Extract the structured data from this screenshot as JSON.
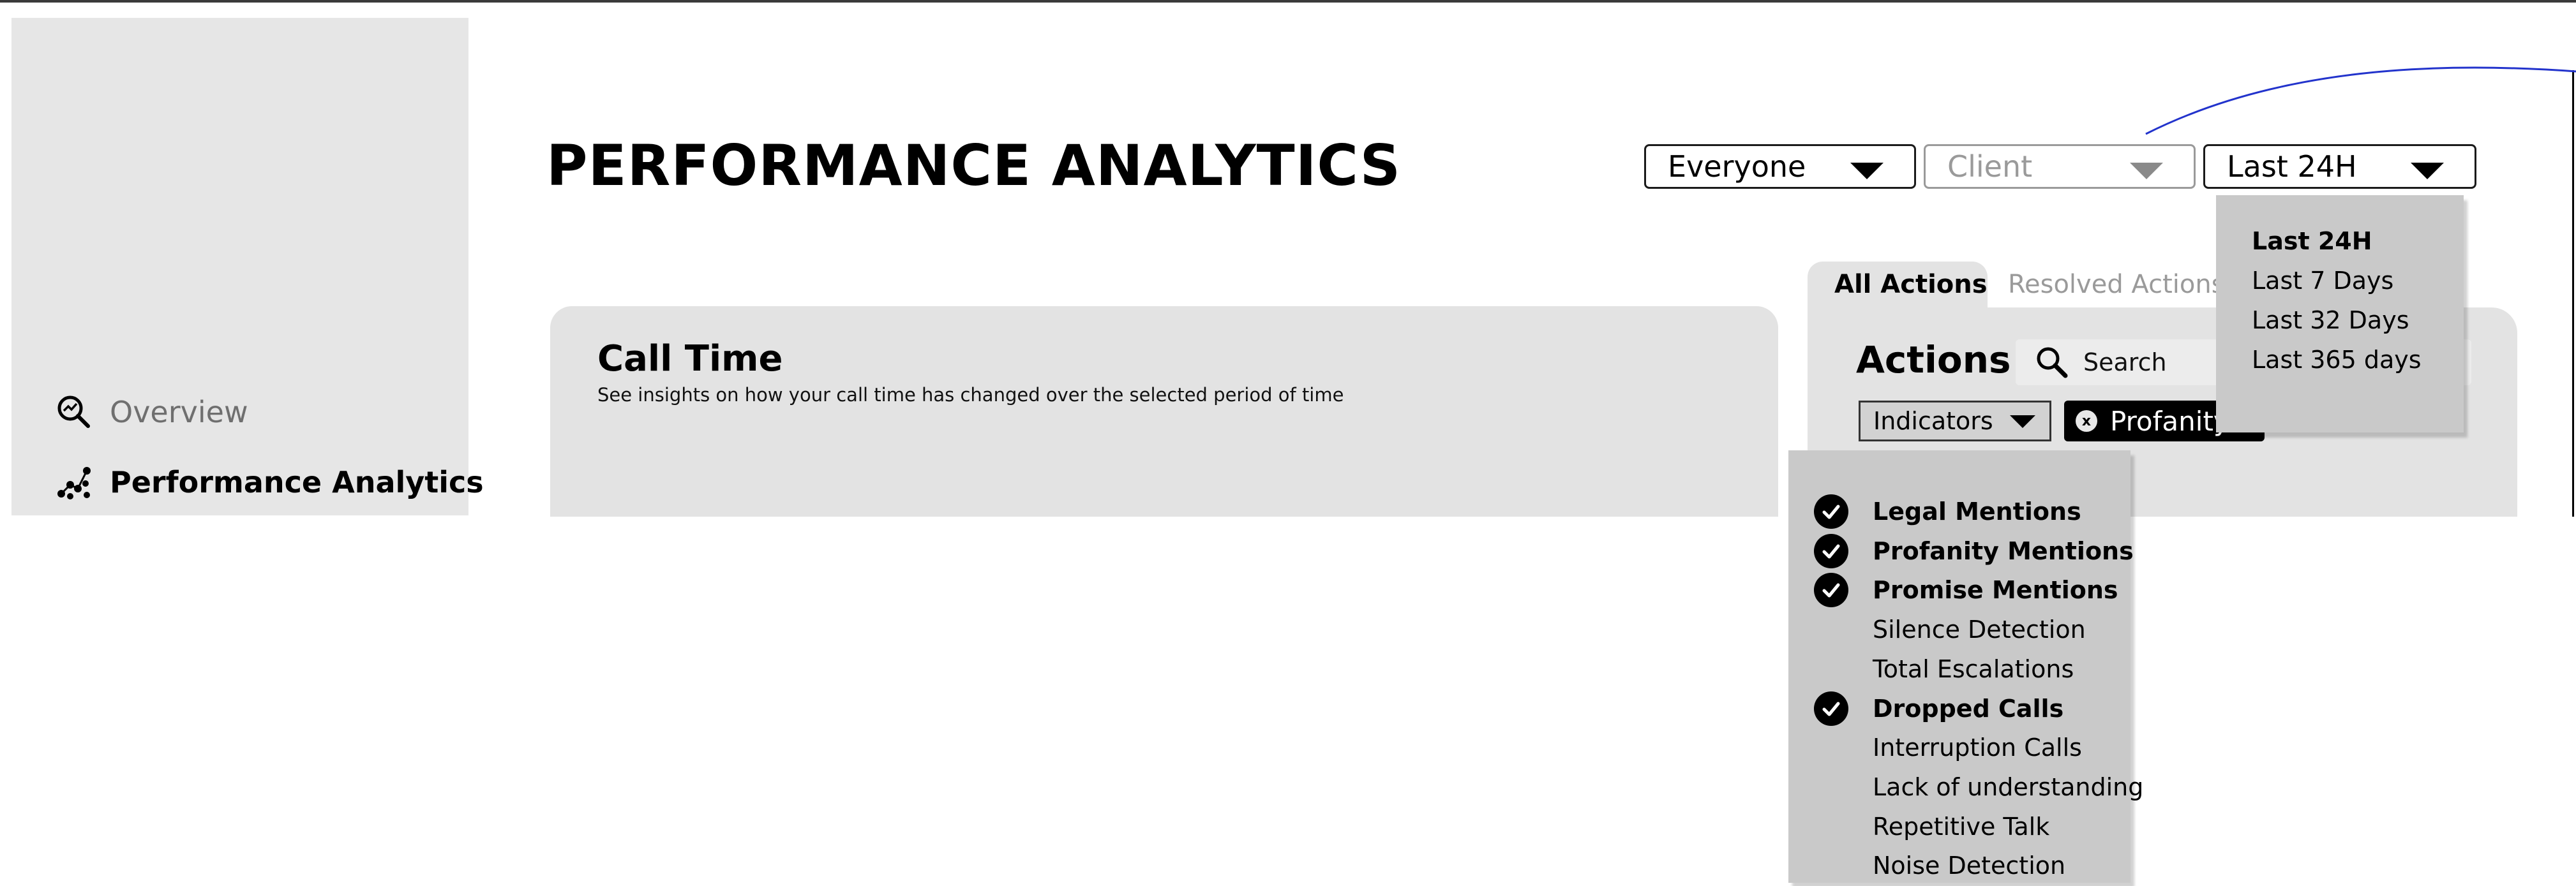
{
  "title": "PERFORMANCE ANALYTICS",
  "sidebar": {
    "items": [
      {
        "label": "Overview",
        "icon": "overview-icon",
        "active": false
      },
      {
        "label": "Performance Analytics",
        "icon": "analytics-icon",
        "active": true
      }
    ]
  },
  "filters": {
    "audience": "Everyone",
    "client_placeholder": "Client",
    "time_range": "Last 24H"
  },
  "time_range_menu": {
    "options": [
      "Last 24H",
      "Last 7 Days",
      "Last 32 Days",
      "Last 365 days"
    ],
    "selected": "Last 24H"
  },
  "call_time": {
    "title": "Call Time",
    "subtitle": "See insights on how your call time has changed over the selected period of time"
  },
  "actions": {
    "tabs": [
      "All Actions",
      "Resolved Actions",
      "s"
    ],
    "active_tab": "All Actions",
    "title": "Actions",
    "search_placeholder": "Search",
    "indicators_label": "Indicators",
    "chip_label": "Profanity",
    "chip_close": "x"
  },
  "indicators_menu": {
    "items": [
      {
        "label": "Legal Mentions",
        "checked": true
      },
      {
        "label": "Profanity Mentions",
        "checked": true
      },
      {
        "label": "Promise Mentions",
        "checked": true
      },
      {
        "label": "Silence Detection",
        "checked": false
      },
      {
        "label": "Total Escalations",
        "checked": false
      },
      {
        "label": "Dropped Calls",
        "checked": true
      },
      {
        "label": "Interruption Calls",
        "checked": false
      },
      {
        "label": "Lack of understanding",
        "checked": false
      },
      {
        "label": "Repetitive Talk",
        "checked": false
      },
      {
        "label": "Noise Detection",
        "checked": false
      }
    ]
  },
  "colors": {
    "panel_bg": "#e3e3e3",
    "menu_bg": "#c9c9c9",
    "muted_text": "#9a9a9a",
    "annotation_line": "#2233cc"
  }
}
